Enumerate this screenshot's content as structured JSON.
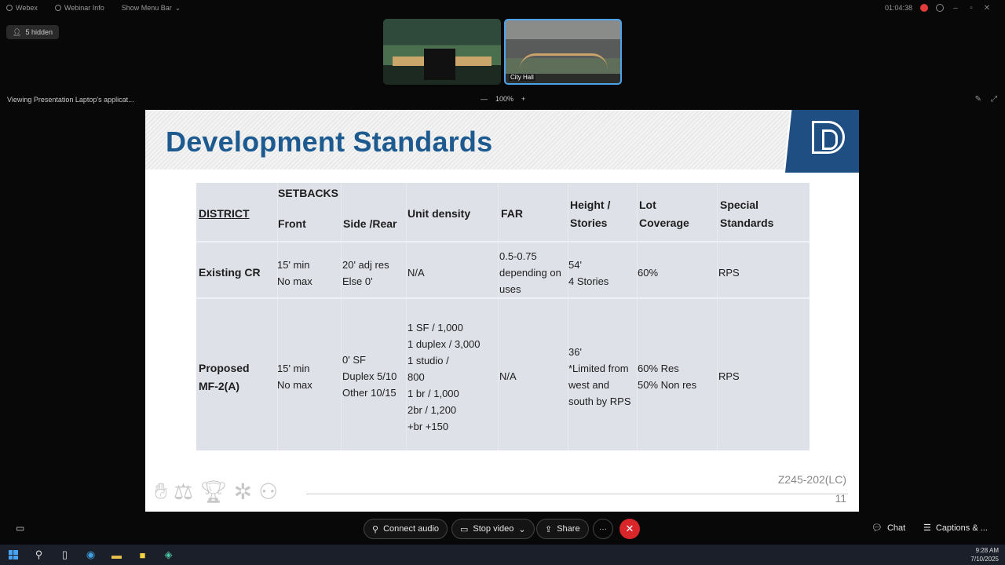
{
  "titlebar": {
    "app_name": "Webex",
    "webinar_info": "Webinar Info",
    "menu_bar": "Show Menu Bar",
    "timer": "01:04:38"
  },
  "hidden_participants": "5 hidden",
  "thumbnails": {
    "second_label": "City Hall"
  },
  "share_status": "Viewing Presentation Laptop's applicat...",
  "zoom": {
    "minus": "—",
    "level": "100%",
    "plus": "+"
  },
  "slide": {
    "title": "Development Standards",
    "table": {
      "headers": {
        "district": "DISTRICT",
        "setbacks": "SETBACKS",
        "front": "Front",
        "side_rear": "Side /Rear",
        "unit_density": "Unit density",
        "far": "FAR",
        "height_stories": "Height        /\nStories",
        "lot_coverage": "Lot\nCoverage",
        "special_standards": "Special\nStandards"
      },
      "rows": [
        {
          "district": "Existing CR",
          "front": "15' min\nNo max",
          "side_rear": "20' adj res\nElse 0'",
          "unit_density": "N/A",
          "far": "0.5-0.75\ndepending on\nuses",
          "height_stories": "54'\n4 Stories",
          "lot_coverage": "60%",
          "special_standards": "RPS"
        },
        {
          "district": "Proposed\nMF-2(A)",
          "front": "15' min\nNo max",
          "side_rear": "0' SF\nDuplex 5/10\nOther 10/15",
          "unit_density": "1 SF / 1,000\n1 duplex / 3,000\n1 studio /\n800\n1 br / 1,000\n2br / 1,200\n+br +150",
          "far": "N/A",
          "height_stories": "36'\n*Limited from\nwest        and\nsouth by RPS",
          "lot_coverage": "60% Res\n50% Non res",
          "special_standards": "RPS"
        }
      ]
    },
    "case_number": "Z245-202(LC)",
    "page_number": "11"
  },
  "controls": {
    "connect_audio": "Connect audio",
    "stop_video": "Stop video",
    "share": "Share",
    "chat": "Chat",
    "captions": "Captions & ..."
  },
  "taskbar": {
    "time": "9:28 AM",
    "date": "7/10/2025"
  },
  "colors": {
    "title_blue": "#1d5a90",
    "logo_blue": "#1f4e82",
    "end_call_red": "#d8262b",
    "active_video_border": "#4ea2e8"
  }
}
